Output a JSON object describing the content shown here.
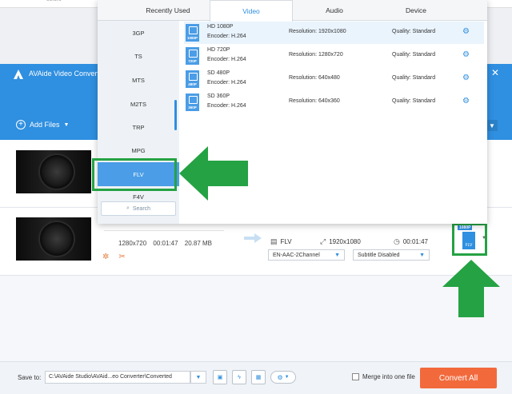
{
  "desktop": {
    "tiny_text": "colors"
  },
  "app": {
    "title": "AVAide Video Converter (",
    "close": "✕"
  },
  "toolbar": {
    "add_files": "Add Files"
  },
  "popup": {
    "tabs": [
      "Recently Used",
      "Video",
      "Audio",
      "Device"
    ],
    "active_tab": "Video",
    "formats": [
      "3GP",
      "TS",
      "MTS",
      "M2TS",
      "TRP",
      "MPG",
      "FLV",
      "F4V"
    ],
    "selected_format": "FLV",
    "search_placeholder": "Search",
    "presets": [
      {
        "badge": "1080P",
        "name": "HD 1080P",
        "encoder": "Encoder: H.264",
        "resolution": "Resolution: 1920x1080",
        "quality": "Quality: Standard"
      },
      {
        "badge": "720P",
        "name": "HD 720P",
        "encoder": "Encoder: H.264",
        "resolution": "Resolution: 1280x720",
        "quality": "Quality: Standard"
      },
      {
        "badge": "480P",
        "name": "SD 480P",
        "encoder": "Encoder: H.264",
        "resolution": "Resolution: 640x480",
        "quality": "Quality: Standard"
      },
      {
        "badge": "360P",
        "name": "SD 360P",
        "encoder": "Encoder: H.264",
        "resolution": "Resolution: 640x360",
        "quality": "Quality: Standard"
      }
    ]
  },
  "file": {
    "resolution": "1280x720",
    "duration": "00:01:47",
    "size": "20.87 MB",
    "out_format": "FLV",
    "out_resolution": "1920x1080",
    "out_duration": "00:01:47",
    "audio": "EN-AAC-2Channel",
    "subtitle": "Subtitle Disabled",
    "badge_top": "1080P",
    "badge_fmt": "FLV"
  },
  "bottom": {
    "save_to": "Save to:",
    "path": "C:\\AVAide Studio\\AVAid...eo Converter\\Converted",
    "merge": "Merge into one file",
    "convert_all": "Convert All"
  },
  "colors": {
    "accent": "#2f8fe0",
    "convert": "#f26a3c",
    "highlight": "#25a244"
  }
}
